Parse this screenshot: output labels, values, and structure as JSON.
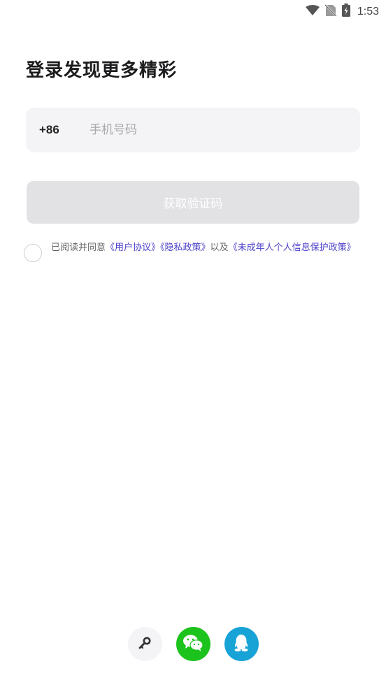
{
  "status_bar": {
    "time": "1:53",
    "icons": [
      "wifi-icon",
      "no-sim-icon",
      "battery-charging-icon"
    ]
  },
  "login": {
    "title": "登录发现更多精彩",
    "country_code": "+86",
    "phone_placeholder": "手机号码",
    "phone_value": "",
    "get_code_button": "获取验证码"
  },
  "agreement": {
    "checked": false,
    "prefix": "已阅读并同意",
    "user_agreement": "《用户协议》",
    "privacy_policy": "《隐私政策》",
    "connector": "以及",
    "minor_policy": "《未成年人个人信息保护政策》"
  },
  "other_login": {
    "icons": [
      "key-icon",
      "wechat-icon",
      "qq-icon"
    ],
    "colors": {
      "wechat": "#1dc31d",
      "qq": "#18a3d6"
    }
  }
}
